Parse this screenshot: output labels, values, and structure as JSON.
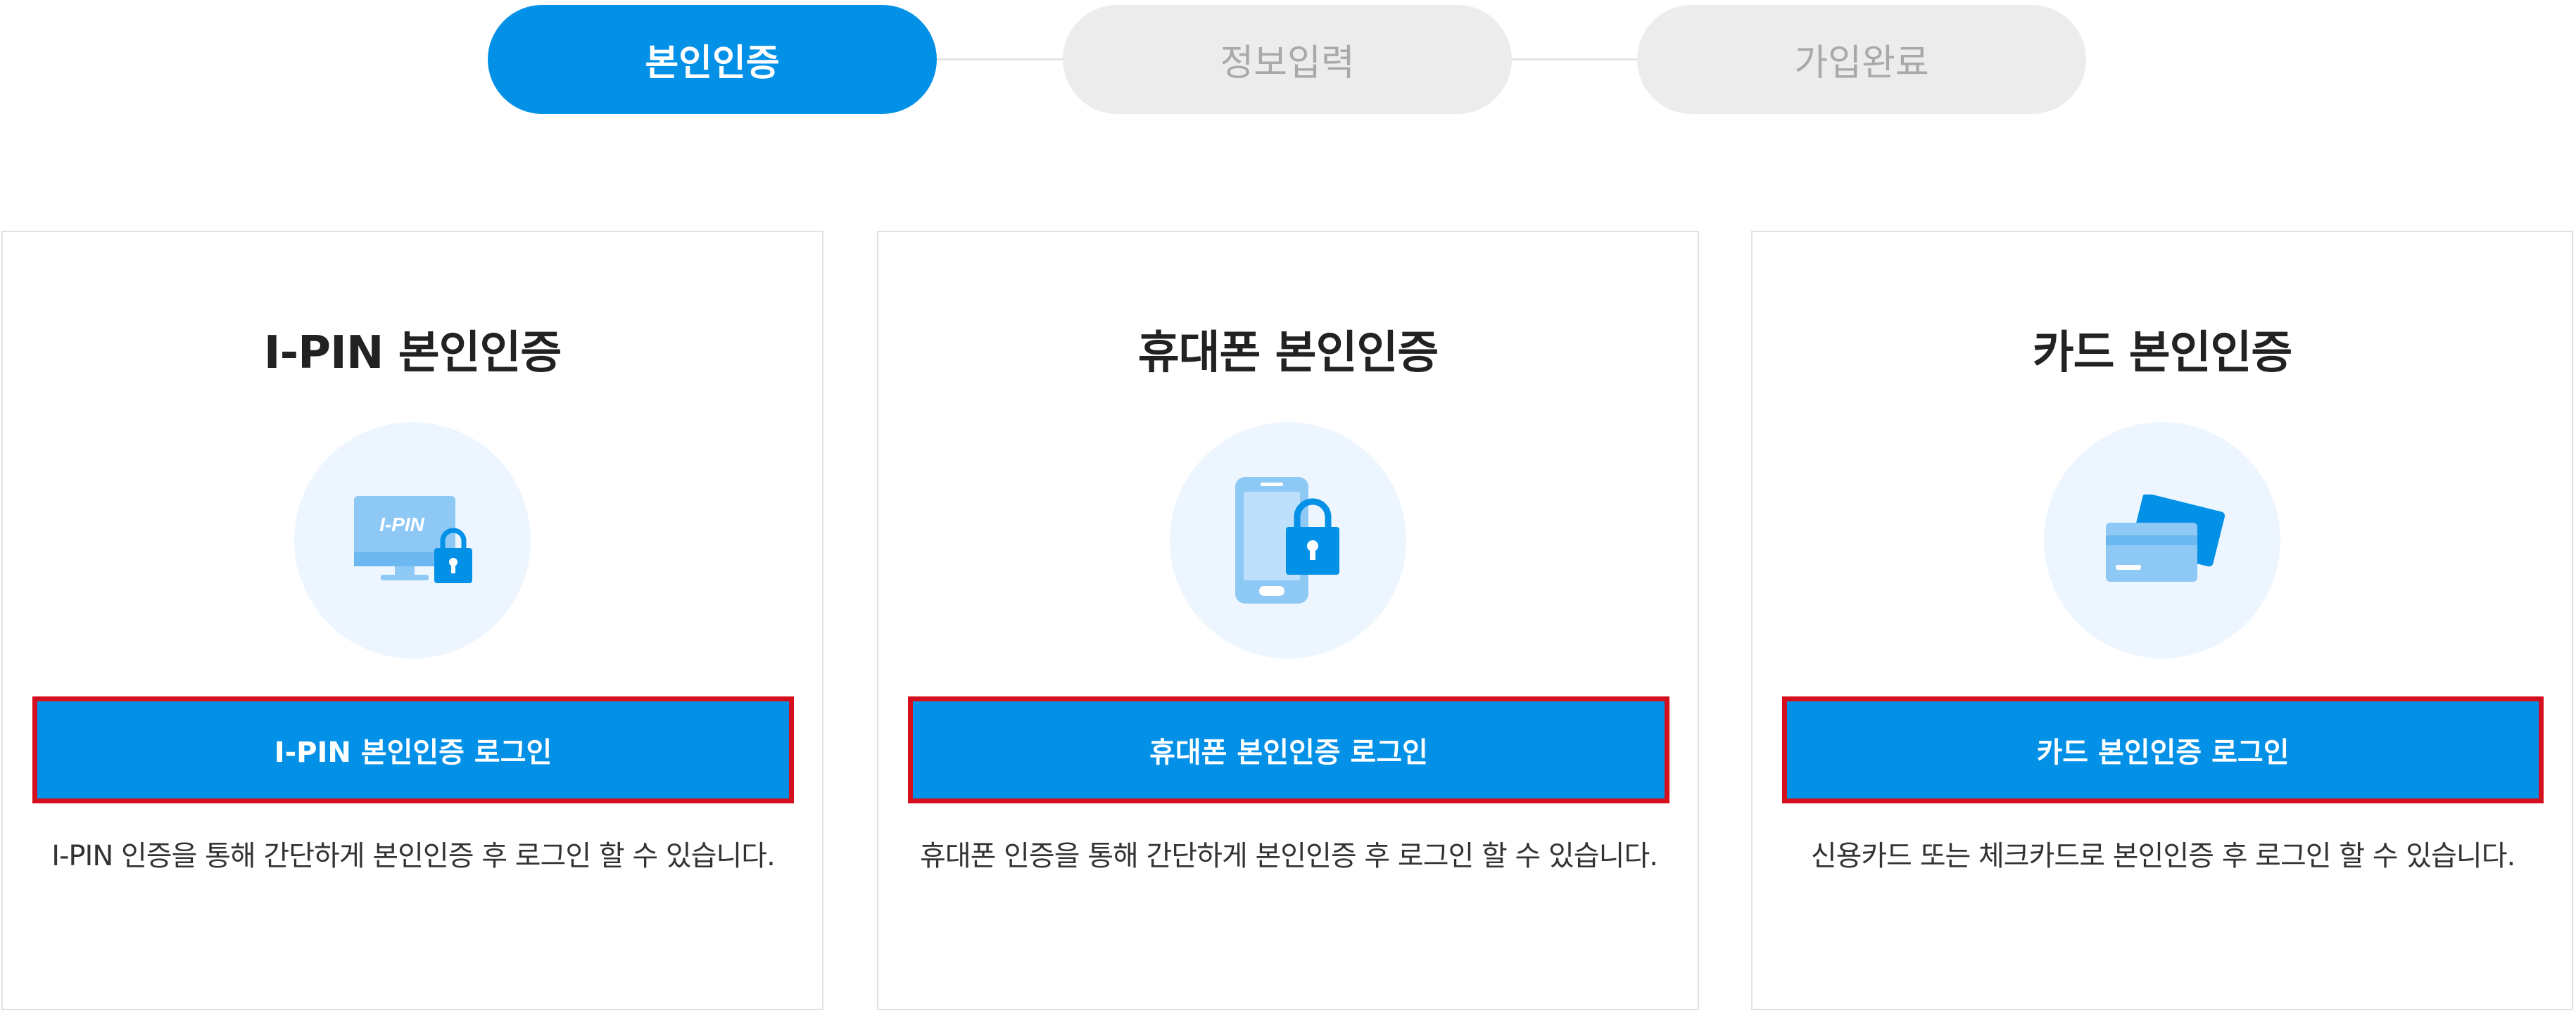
{
  "steps": [
    {
      "label": "본인인증",
      "state": "active"
    },
    {
      "label": "정보입력",
      "state": "inactive"
    },
    {
      "label": "가입완료",
      "state": "inactive"
    }
  ],
  "cards": [
    {
      "title": "I-PIN 본인인증",
      "icon": "monitor-lock-icon",
      "icon_text": "I-PIN",
      "button": "I-PIN 본인인증 로그인",
      "description": "I-PIN 인증을 통해 간단하게 본인인증 후 로그인 할 수 있습니다."
    },
    {
      "title": "휴대폰 본인인증",
      "icon": "phone-lock-icon",
      "button": "휴대폰 본인인증 로그인",
      "description": "휴대폰 인증을 통해 간단하게 본인인증 후 로그인 할 수 있습니다."
    },
    {
      "title": "카드 본인인증",
      "icon": "credit-card-icon",
      "button": "카드 본인인증 로그인",
      "description": "신용카드 또는 체크카드로 본인인증 후 로그인 할 수 있습니다."
    }
  ],
  "colors": {
    "primary": "#0391e8",
    "highlight_border": "#d5101e",
    "step_inactive_bg": "#ececec",
    "step_inactive_text": "#a9a9a9",
    "icon_circle_bg": "#edf6fe"
  }
}
